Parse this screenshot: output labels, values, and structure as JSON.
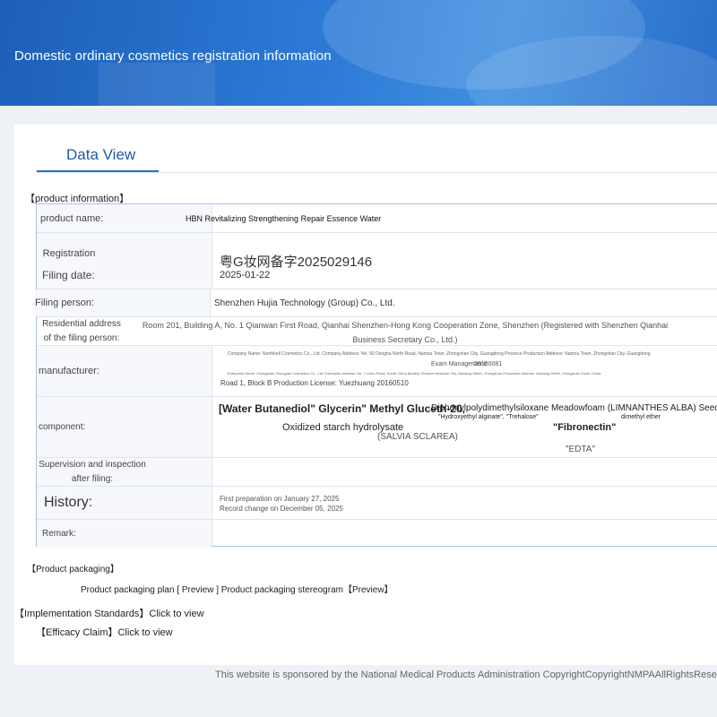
{
  "header": {
    "title": "Domestic ordinary cosmetics registration information"
  },
  "tabs": [
    {
      "label": "Data View"
    }
  ],
  "product_section": {
    "title": "【product information】"
  },
  "fields": {
    "product_name": {
      "label": "product name:",
      "value": "HBN Revitalizing Strengthening Repair Essence Water"
    },
    "registration_number": {
      "label": "Registration Number:",
      "value": "粤G妆网备字2025029146"
    },
    "filing_date": {
      "label": "Filing date:",
      "value": "2025-01-22"
    },
    "filing_person": {
      "label": "Filing person:",
      "value": "Shenzhen Hujia Technology (Group) Co., Ltd."
    },
    "residential_address": {
      "label": "Residential address of the filing person:",
      "value": "Room 201, Building A, No. 1 Qianwan First Road, Qianhai Shenzhen-Hong Kong Cooperation Zone, Shenzhen (Registered with Shenzhen Qianhai Business Secretary Co., Ltd.)"
    },
    "manufacturer": {
      "label": "manufacturer:",
      "line1": "Company Name: Northbell Cosmetics Co., Ltd. Company Address: No. 50 Donghu North Road, Nantou Town, Zhongshan City, Guangdong Province Production Address: Nantou Town, Zhongshan City, Guangdong",
      "line2": "Exam Management:",
      "line2b": "20180081",
      "line3": "Enterprise Name: Zhongshan Zhongyan Cosmetics Co., Ltd. Enterprise Address: No. 7 Liuhu Road, South China Modern Chinese Medicine City, Nanlang Street, Zhongshan Production Address: Nanlang Street, Zhongshan South China",
      "line4": "Road 1, Block B Production License: Yuezhuang 20160510"
    },
    "component": {
      "label": "component:",
      "line1": "[Water Butanediol\" Glycerin\" Methyl Gluceth-20,",
      "line1b": "Diphenylpolydimethylsiloxane Meadowfoam (LIMNANTHES ALBA) Seed Oil",
      "line1c": "\"Hydroxyethyl alginate\", \"Trehalose\"",
      "line1d": "dimethyl ether",
      "line2": "Oxidized starch hydrolysate",
      "line2b": "\"Fibronectin\"",
      "line3": "(SALVIA SCLAREA)",
      "line4": "\"EDTA\""
    },
    "supervision": {
      "label": "Supervision and inspection after filing:",
      "value": ""
    },
    "history": {
      "label": "History:",
      "line1": "First preparation on January 27, 2025",
      "line2": "Record change on December 05, 2025"
    },
    "remark": {
      "label": "Remark:",
      "value": ""
    }
  },
  "packaging": {
    "title": "【Product packaging】",
    "plan_label": "Product packaging plan",
    "plan_preview": "[ Preview ]",
    "stereogram_label": "Product packaging stereogram",
    "stereogram_preview": "【Preview】"
  },
  "standards": {
    "title": "【Implementation Standards】",
    "link": "Click to view"
  },
  "efficacy": {
    "title": "【Efficacy Claim】",
    "link": "Click to view"
  },
  "footer": {
    "text": "This website is sponsored by the National Medical Products Administration CopyrightCopyrightNMPAAllRightsReserved"
  }
}
